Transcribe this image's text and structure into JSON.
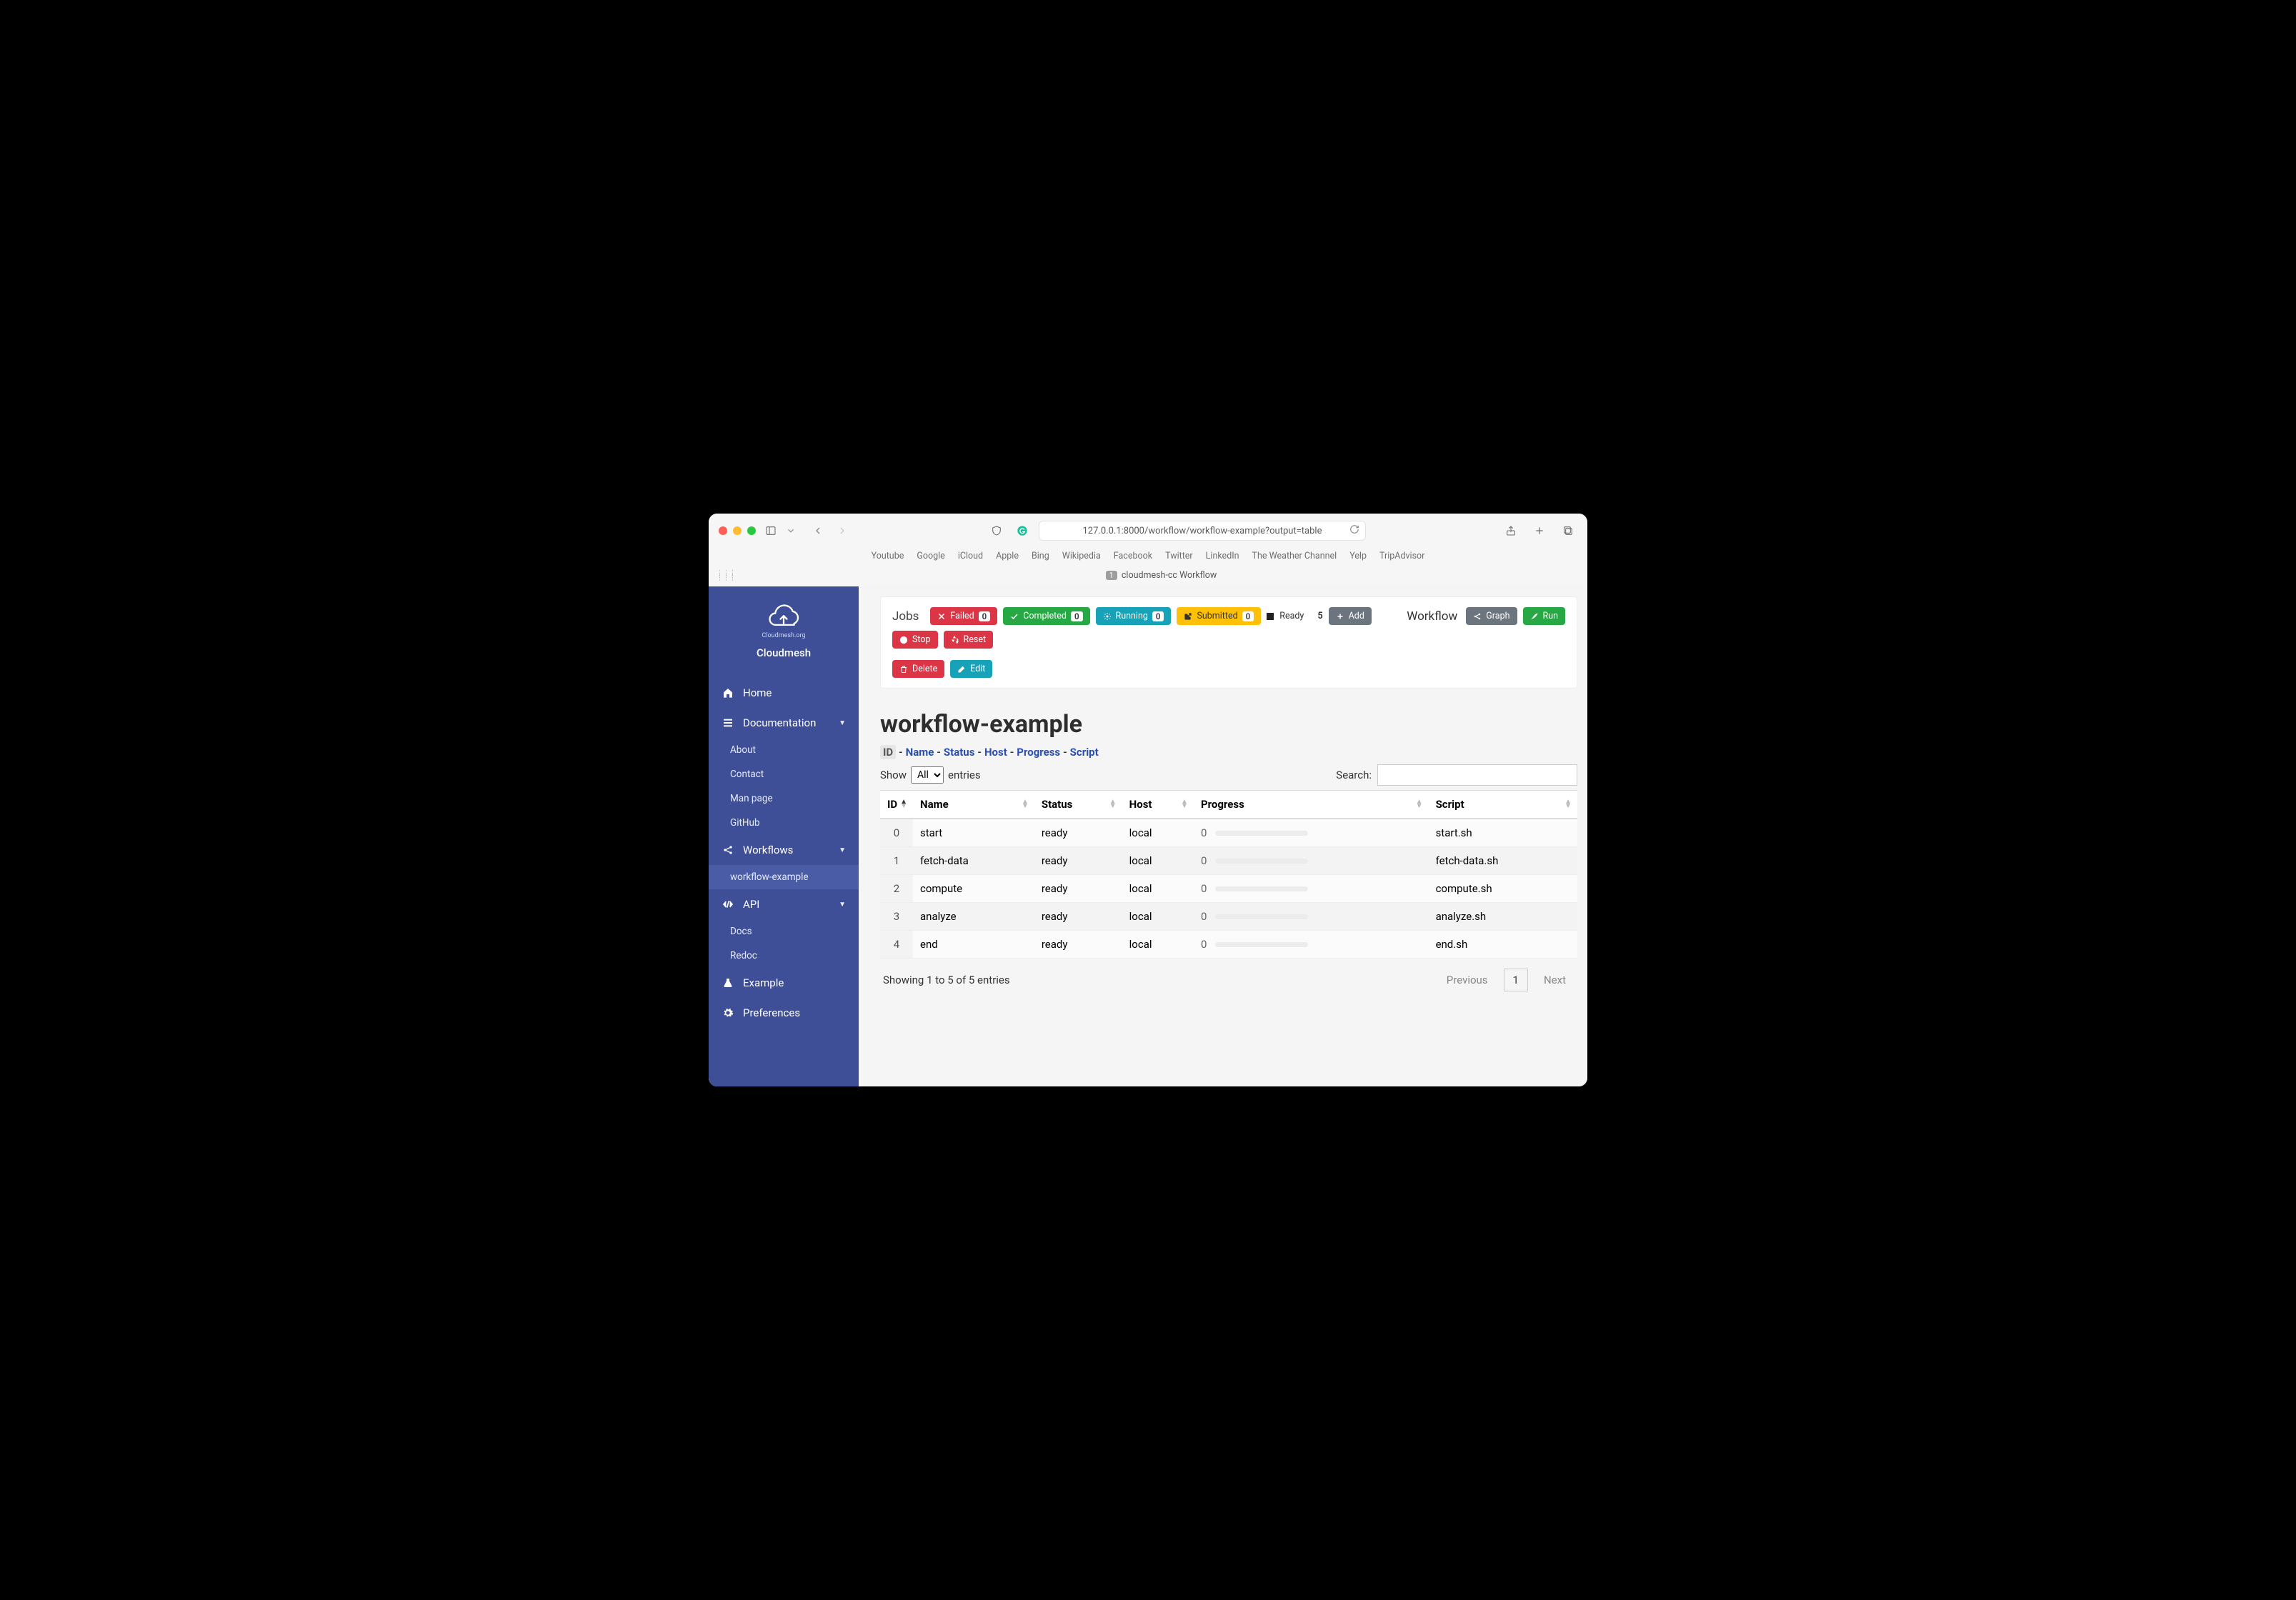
{
  "browser": {
    "url": "127.0.0.1:8000/workflow/workflow-example?output=table",
    "bookmarks": [
      "Youtube",
      "Google",
      "iCloud",
      "Apple",
      "Bing",
      "Wikipedia",
      "Facebook",
      "Twitter",
      "LinkedIn",
      "The Weather Channel",
      "Yelp",
      "TripAdvisor"
    ],
    "tab_badge": "1",
    "tab_title": "cloudmesh-cc Workflow"
  },
  "sidebar": {
    "brand_sub": "Cloudmesh.org",
    "brand_name": "Cloudmesh",
    "items": [
      {
        "label": "Home"
      },
      {
        "label": "Documentation"
      },
      {
        "label": "About"
      },
      {
        "label": "Contact"
      },
      {
        "label": "Man page"
      },
      {
        "label": "GitHub"
      },
      {
        "label": "Workflows"
      },
      {
        "label": "workflow-example"
      },
      {
        "label": "API"
      },
      {
        "label": "Docs"
      },
      {
        "label": "Redoc"
      },
      {
        "label": "Example"
      },
      {
        "label": "Preferences"
      }
    ]
  },
  "toolbar": {
    "jobs_label": "Jobs",
    "failed": {
      "label": "Failed",
      "count": "0"
    },
    "completed": {
      "label": "Completed",
      "count": "0"
    },
    "running": {
      "label": "Running",
      "count": "0"
    },
    "submitted": {
      "label": "Submitted",
      "count": "0"
    },
    "ready": {
      "label": "Ready",
      "count": "5"
    },
    "add": "Add",
    "delete": "Delete",
    "edit": "Edit",
    "workflow_label": "Workflow",
    "graph": "Graph",
    "run": "Run",
    "stop": "Stop",
    "reset": "Reset"
  },
  "page": {
    "title": "workflow-example",
    "crumbs": [
      "ID",
      "Name",
      "Status",
      "Host",
      "Progress",
      "Script"
    ],
    "show_label": "Show",
    "entries_label": "entries",
    "length_options": [
      "All"
    ],
    "length_selected": "All",
    "search_label": "Search:",
    "columns": [
      "ID",
      "Name",
      "Status",
      "Host",
      "Progress",
      "Script"
    ],
    "info": "Showing 1 to 5 of 5 entries",
    "prev": "Previous",
    "next": "Next",
    "page_current": "1"
  },
  "chart_data": {
    "type": "table",
    "columns": [
      "ID",
      "Name",
      "Status",
      "Host",
      "Progress",
      "Script"
    ],
    "rows": [
      {
        "id": "0",
        "name": "start",
        "status": "ready",
        "host": "local",
        "progress": 0,
        "script": "start.sh"
      },
      {
        "id": "1",
        "name": "fetch-data",
        "status": "ready",
        "host": "local",
        "progress": 0,
        "script": "fetch-data.sh"
      },
      {
        "id": "2",
        "name": "compute",
        "status": "ready",
        "host": "local",
        "progress": 0,
        "script": "compute.sh"
      },
      {
        "id": "3",
        "name": "analyze",
        "status": "ready",
        "host": "local",
        "progress": 0,
        "script": "analyze.sh"
      },
      {
        "id": "4",
        "name": "end",
        "status": "ready",
        "host": "local",
        "progress": 0,
        "script": "end.sh"
      }
    ]
  }
}
